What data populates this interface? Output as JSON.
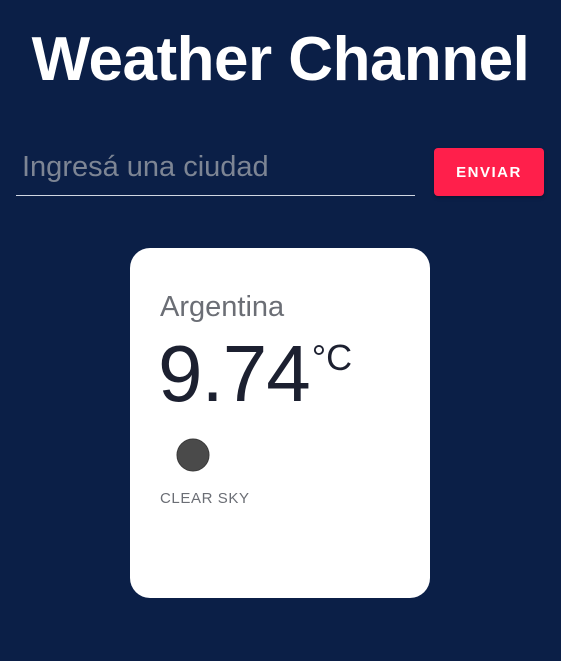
{
  "header": {
    "title": "Weather Channel"
  },
  "search": {
    "placeholder": "Ingresá una ciudad",
    "value": "",
    "submit_label": "ENVIAR"
  },
  "weather": {
    "city": "Argentina",
    "temperature": "9.74",
    "unit": "°C",
    "condition": "CLEAR SKY",
    "icon": "clear-sky-icon"
  },
  "colors": {
    "background": "#0b1f47",
    "accent": "#ff1f4b",
    "card": "#ffffff"
  }
}
